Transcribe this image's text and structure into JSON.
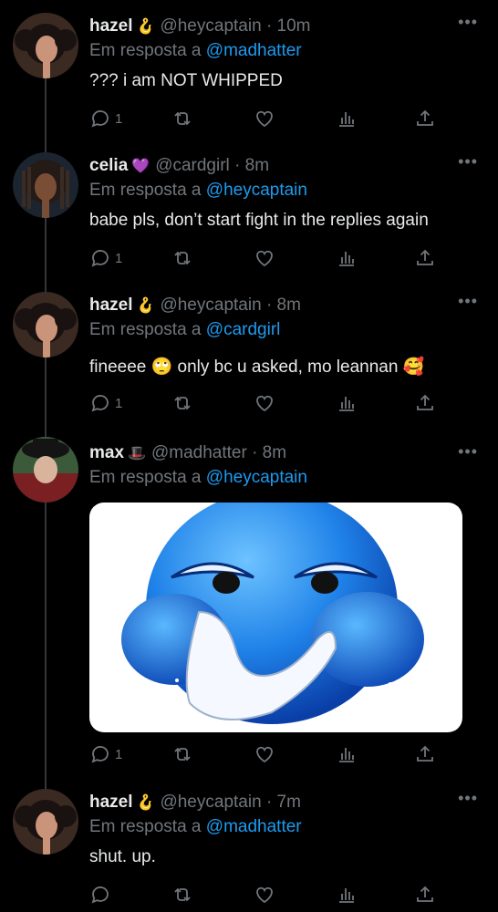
{
  "tweets": [
    {
      "name": "hazel",
      "badge": "🪝",
      "handle": "@heycaptain",
      "time": "· 10m",
      "reply_prefix": "Em resposta a",
      "reply_to": "@madhatter",
      "text": "??? i am NOT WHIPPED",
      "reply_count": "1"
    },
    {
      "name": "celia",
      "badge": "💜",
      "handle": "@cardgirl",
      "time": "· 8m",
      "reply_prefix": "Em resposta a",
      "reply_to": "@heycaptain",
      "text": "babe pls, don’t start fight in the replies again",
      "reply_count": "1"
    },
    {
      "name": "hazel",
      "badge": "🪝",
      "handle": "@heycaptain",
      "time": "· 8m",
      "reply_prefix": "Em resposta a",
      "reply_to": "@cardgirl",
      "text": "fineeee 🙄  only bc u asked, mo leannan 🥰",
      "reply_count": "1"
    },
    {
      "name": "max",
      "badge": "🎩",
      "handle": "@madhatter",
      "time": "· 8m",
      "reply_prefix": "Em resposta a",
      "reply_to": "@heycaptain",
      "text": "",
      "reply_count": "1"
    },
    {
      "name": "hazel",
      "badge": "🪝",
      "handle": "@heycaptain",
      "time": "· 7m",
      "reply_prefix": "Em resposta a",
      "reply_to": "@madhatter",
      "text": "shut. up.",
      "reply_count": ""
    }
  ],
  "icons": {
    "reply": "reply-icon",
    "retweet": "retweet-icon",
    "like": "heart-icon",
    "stats": "stats-icon",
    "share": "share-icon",
    "more": "more-icon"
  },
  "colors": {
    "background": "#000000",
    "text": "#e7e9ea",
    "secondary": "#71767b",
    "accent": "#1d9bf0"
  }
}
